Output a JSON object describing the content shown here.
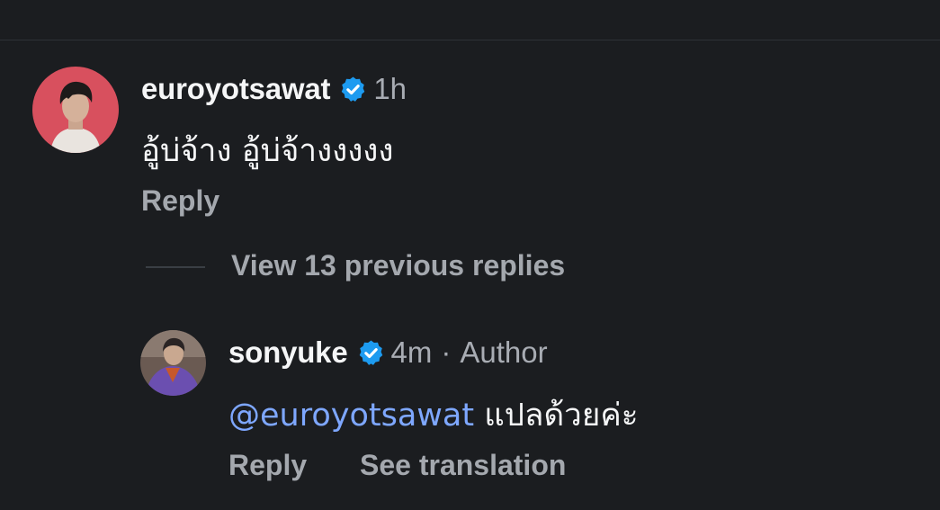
{
  "comments": [
    {
      "username": "euroyotsawat",
      "verified": true,
      "time": "1h",
      "text": "อู้บ่จ้าง อู้บ่จ้างงงงง",
      "reply_label": "Reply"
    }
  ],
  "view_replies_label": "View 13 previous replies",
  "replies": [
    {
      "username": "sonyuke",
      "verified": true,
      "time": "4m",
      "separator": "·",
      "badge": "Author",
      "mention": "@euroyotsawat",
      "text": " แปลด้วยค่ะ",
      "reply_label": "Reply",
      "translate_label": "See translation"
    }
  ],
  "colors": {
    "background": "#1b1d20",
    "verified_badge": "#1d9bf0",
    "mention": "#7ea7ff",
    "secondary_text": "#a8acb3"
  },
  "icons": {
    "verified": "verified-badge-icon"
  }
}
